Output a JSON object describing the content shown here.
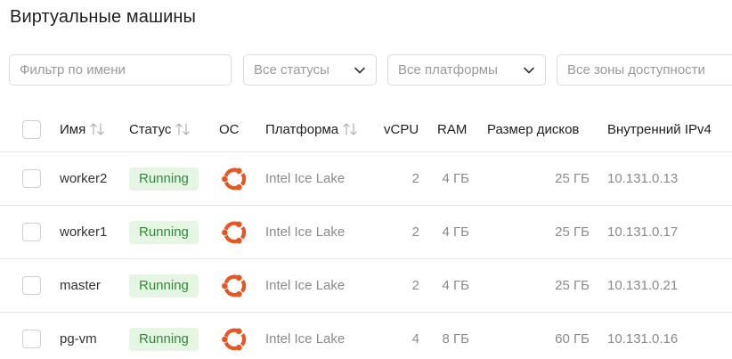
{
  "page": {
    "title": "Виртуальные машины"
  },
  "filters": {
    "name_placeholder": "Фильтр по имени",
    "status": "Все статусы",
    "platform": "Все платформы",
    "zone": "Все зоны доступности"
  },
  "table": {
    "columns": {
      "name": "Имя",
      "status": "Статус",
      "os": "ОС",
      "platform": "Платформа",
      "vcpu": "vCPU",
      "ram": "RAM",
      "disk": "Размер дисков",
      "ip": "Внутренний IPv4"
    },
    "rows": [
      {
        "name": "worker2",
        "status": "Running",
        "os_icon": "ubuntu-icon",
        "platform": "Intel Ice Lake",
        "vcpu": "2",
        "ram": "4 ГБ",
        "disk": "25 ГБ",
        "ip": "10.131.0.13"
      },
      {
        "name": "worker1",
        "status": "Running",
        "os_icon": "ubuntu-icon",
        "platform": "Intel Ice Lake",
        "vcpu": "2",
        "ram": "4 ГБ",
        "disk": "25 ГБ",
        "ip": "10.131.0.17"
      },
      {
        "name": "master",
        "status": "Running",
        "os_icon": "ubuntu-icon",
        "platform": "Intel Ice Lake",
        "vcpu": "2",
        "ram": "4 ГБ",
        "disk": "25 ГБ",
        "ip": "10.131.0.21"
      },
      {
        "name": "pg-vm",
        "status": "Running",
        "os_icon": "ubuntu-icon",
        "platform": "Intel Ice Lake",
        "vcpu": "4",
        "ram": "8 ГБ",
        "disk": "60 ГБ",
        "ip": "10.131.0.16"
      }
    ]
  },
  "colors": {
    "running_bg": "#e5f6e3",
    "running_text": "#2f8b3a",
    "ubuntu_orange": "#e95420"
  }
}
